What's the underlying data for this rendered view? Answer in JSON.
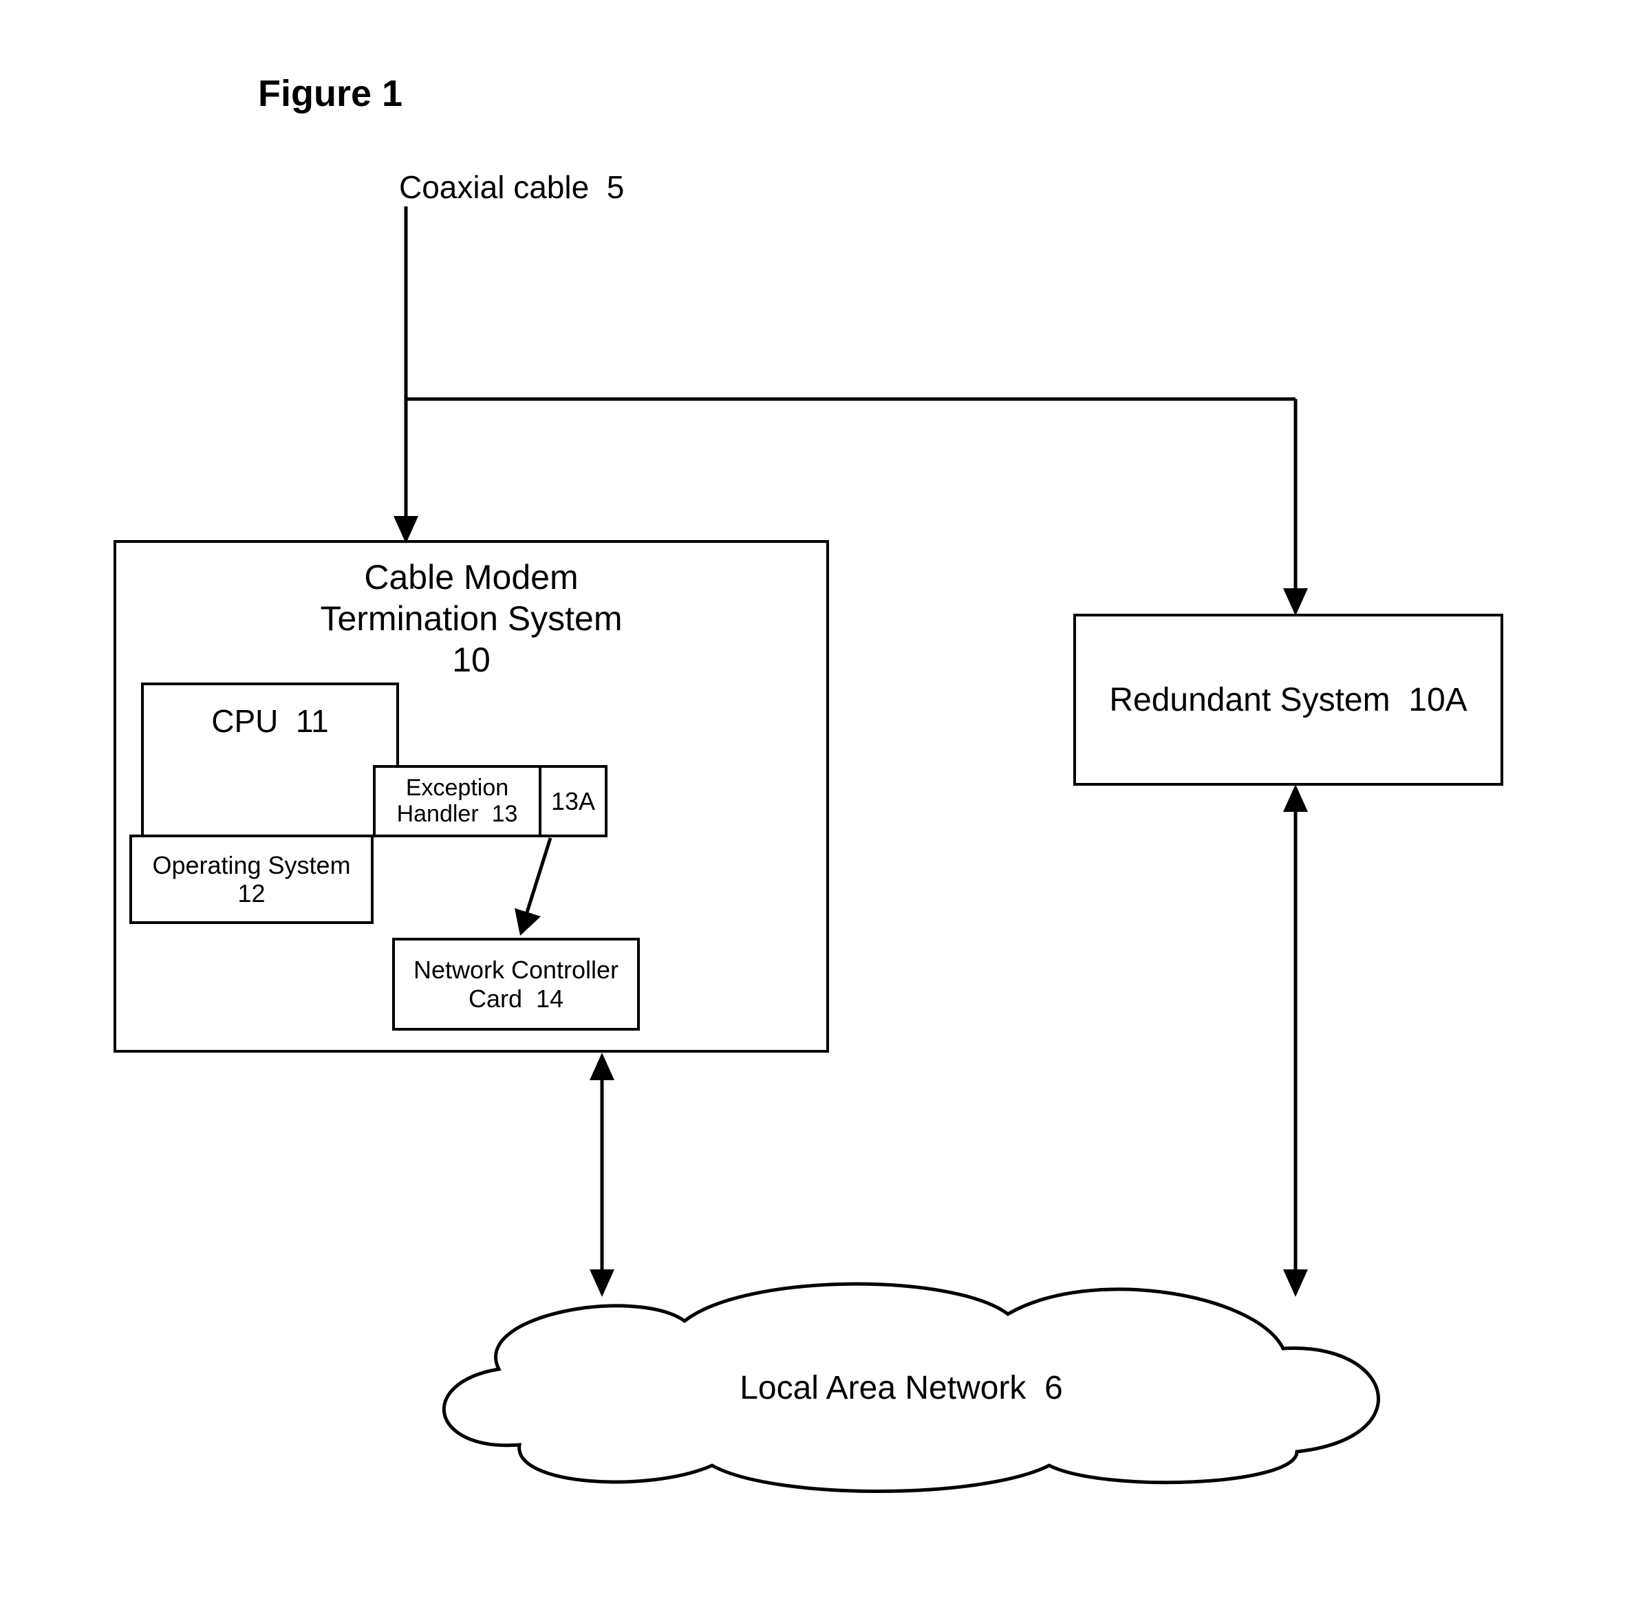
{
  "figure_title": "Figure 1",
  "coax": {
    "label": "Coaxial cable",
    "ref": "5"
  },
  "cmts": {
    "title_line1": "Cable Modem",
    "title_line2": "Termination System",
    "ref": "10",
    "cpu": {
      "label": "CPU",
      "ref": "11"
    },
    "os": {
      "label": "Operating System",
      "ref": "12"
    },
    "exception_handler": {
      "label": "Exception Handler",
      "ref": "13",
      "subref": "13A"
    },
    "ncc": {
      "label": "Network Controller Card",
      "ref": "14"
    }
  },
  "redundant": {
    "label": "Redundant System",
    "ref": "10A"
  },
  "lan": {
    "label": "Local Area Network",
    "ref": "6"
  }
}
